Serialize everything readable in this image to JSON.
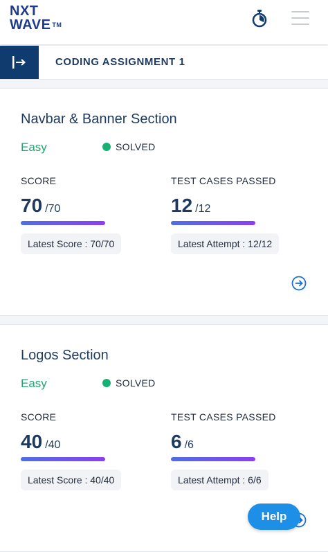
{
  "header": {
    "logo_line1": "NXT",
    "logo_line2": "WAVE",
    "logo_tm": "TM"
  },
  "subheader": {
    "title": "CODING ASSIGNMENT 1"
  },
  "cards": [
    {
      "title": "Navbar & Banner Section",
      "difficulty": "Easy",
      "status": "SOLVED",
      "score_label": "SCORE",
      "score": "70",
      "score_total": "/70",
      "score_fraction": 1.0,
      "latest_score": "Latest Score : 70/70",
      "tests_label": "TEST CASES PASSED",
      "tests": "12",
      "tests_total": "/12",
      "tests_fraction": 1.0,
      "latest_attempt": "Latest Attempt : 12/12"
    },
    {
      "title": "Logos Section",
      "difficulty": "Easy",
      "status": "SOLVED",
      "score_label": "SCORE",
      "score": "40",
      "score_total": "/40",
      "score_fraction": 1.0,
      "latest_score": "Latest Score : 40/40",
      "tests_label": "TEST CASES PASSED",
      "tests": "6",
      "tests_total": "/6",
      "tests_fraction": 1.0,
      "latest_attempt": "Latest Attempt : 6/6"
    }
  ],
  "help": {
    "label": "Help"
  },
  "colors": {
    "brand": "#1e3a8a",
    "easy": "#22a56f",
    "solved_dot": "#16b074",
    "help_bg": "#1d8fe6"
  }
}
